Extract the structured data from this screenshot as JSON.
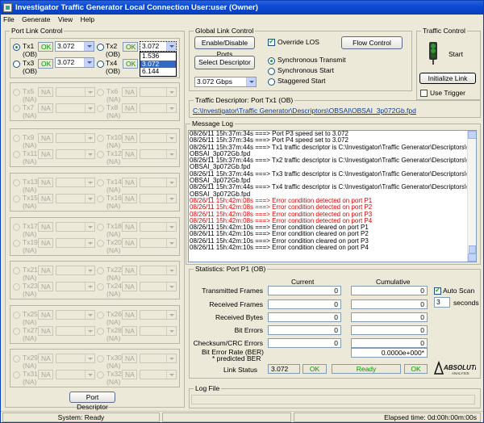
{
  "window": {
    "title": "Investigator  Traffic Generator  Local Connection  User:user (Owner)"
  },
  "menu": [
    "File",
    "Generate",
    "View",
    "Help"
  ],
  "port_link_control": {
    "title": "Port Link Control",
    "active_ports": [
      {
        "label": "Tx1",
        "sub": "(OB)",
        "status": "OK",
        "speed": "3.072"
      },
      {
        "label": "Tx2",
        "sub": "(OB)",
        "status": "OK",
        "speed": "3.072"
      },
      {
        "label": "Tx3",
        "sub": "(OB)",
        "status": "OK",
        "speed": "3.072"
      },
      {
        "label": "Tx4",
        "sub": "(OB)",
        "status": "OK",
        "speed": "3.072"
      }
    ],
    "speed_options": [
      "1.536",
      "3.072",
      "6.144"
    ],
    "selected_speed": "3.072",
    "inactive_groups": [
      [
        [
          "Tx5",
          "(NA)",
          "NA"
        ],
        [
          "Tx6",
          "(NA)",
          "NA"
        ],
        [
          "Tx7",
          "(NA)",
          "NA"
        ],
        [
          "Tx8",
          "(NA)",
          "NA"
        ]
      ],
      [
        [
          "Tx9",
          "(NA)",
          "NA"
        ],
        [
          "Tx10",
          "(NA)",
          "NA"
        ],
        [
          "Tx11",
          "(NA)",
          "NA"
        ],
        [
          "Tx12",
          "(NA)",
          "NA"
        ]
      ],
      [
        [
          "Tx13",
          "(NA)",
          "NA"
        ],
        [
          "Tx14",
          "(NA)",
          "NA"
        ],
        [
          "Tx15",
          "(NA)",
          "NA"
        ],
        [
          "Tx16",
          "(NA)",
          "NA"
        ]
      ],
      [
        [
          "Tx17",
          "(NA)",
          "NA"
        ],
        [
          "Tx18",
          "(NA)",
          "NA"
        ],
        [
          "Tx19",
          "(NA)",
          "NA"
        ],
        [
          "Tx20",
          "(NA)",
          "NA"
        ]
      ],
      [
        [
          "Tx21",
          "(NA)",
          "NA"
        ],
        [
          "Tx22",
          "(NA)",
          "NA"
        ],
        [
          "Tx23",
          "(NA)",
          "NA"
        ],
        [
          "Tx24",
          "(NA)",
          "NA"
        ]
      ],
      [
        [
          "Tx25",
          "(NA)",
          "NA"
        ],
        [
          "Tx26",
          "(NA)",
          "NA"
        ],
        [
          "Tx27",
          "(NA)",
          "NA"
        ],
        [
          "Tx28",
          "(NA)",
          "NA"
        ]
      ],
      [
        [
          "Tx29",
          "(NA)",
          "NA"
        ],
        [
          "Tx30",
          "(NA)",
          "NA"
        ],
        [
          "Tx31",
          "(NA)",
          "NA"
        ],
        [
          "Tx32",
          "(NA)",
          "NA"
        ]
      ]
    ],
    "port_descriptor_button": "Port Descriptor"
  },
  "global_link_control": {
    "title": "Global Link Control",
    "enable_disable_ports": "Enable/Disable Ports",
    "override_los": "Override LOS",
    "flow_control": "Flow Control",
    "select_descriptor": "Select Descriptor",
    "transmit_modes": [
      "Synchronous Transmit",
      "Synchronous Start",
      "Staggered Start"
    ],
    "rate": "3.072 Gbps"
  },
  "traffic_control": {
    "title": "Traffic Control",
    "start": "Start",
    "initialize_link": "Initialize Link",
    "use_trigger": "Use Trigger"
  },
  "traffic_descriptor": {
    "title": "Traffic Descriptor:  Port Tx1 (OB)",
    "path": "C:\\Investigator\\Traffic Generator\\Descriptors\\OBSAI\\OBSAI_3p072Gb.fpd"
  },
  "message_log": {
    "title": "Message Log",
    "lines": [
      {
        "text": "08/26/11 15h:37m:34s  ===> Port P3 speed set to 3.072",
        "color": "#000000"
      },
      {
        "text": "08/26/11 15h:37m:34s  ===> Port P4 speed set to 3.072",
        "color": "#000000"
      },
      {
        "text": "08/26/11 15h:37m:44s  ===> Tx1 traffic descriptor is C:\\Investigator\\Traffic Generator\\Descriptors\\OBSAI\\",
        "color": "#000000"
      },
      {
        "text": "                OBSAI_3p072Gb.fpd",
        "color": "#000000"
      },
      {
        "text": "08/26/11 15h:37m:44s  ===> Tx2 traffic descriptor is C:\\Investigator\\Traffic Generator\\Descriptors\\OBSAI\\",
        "color": "#000000"
      },
      {
        "text": "                OBSAI_3p072Gb.fpd",
        "color": "#000000"
      },
      {
        "text": "08/26/11 15h:37m:44s  ===> Tx3 traffic descriptor is C:\\Investigator\\Traffic Generator\\Descriptors\\OBSAI\\",
        "color": "#000000"
      },
      {
        "text": "                OBSAI_3p072Gb.fpd",
        "color": "#000000"
      },
      {
        "text": "08/26/11 15h:37m:44s  ===> Tx4 traffic descriptor is C:\\Investigator\\Traffic Generator\\Descriptors\\OBSAI\\",
        "color": "#000000"
      },
      {
        "text": "                OBSAI_3p072Gb.fpd",
        "color": "#000000"
      },
      {
        "text": "08/26/11 15h:42m:08s  ===> Error condition detected on port P1",
        "color": "#e00000"
      },
      {
        "text": "08/26/11 15h:42m:08s  ===> Error condition detected on port P2",
        "color": "#e00000"
      },
      {
        "text": "08/26/11 15h:42m:08s  ===> Error condition detected on port P3",
        "color": "#e00000"
      },
      {
        "text": "08/26/11 15h:42m:08s  ===> Error condition detected on port P4",
        "color": "#e00000"
      },
      {
        "text": "08/26/11 15h:42m:10s  ===> Error condition cleared on port P1",
        "color": "#000000"
      },
      {
        "text": "08/26/11 15h:42m:10s  ===> Error condition cleared on port P2",
        "color": "#000000"
      },
      {
        "text": "08/26/11 15h:42m:10s  ===> Error condition cleared on port P3",
        "color": "#000000"
      },
      {
        "text": "08/26/11 15h:42m:10s  ===> Error condition cleared on port P4",
        "color": "#000000"
      }
    ]
  },
  "statistics": {
    "title": "Statistics:  Port P1 (OB)",
    "current_header": "Current",
    "cumulative_header": "Cumulative",
    "rows": [
      {
        "label": "Transmitted Frames",
        "current": "0",
        "cumulative": "0"
      },
      {
        "label": "Received Frames",
        "current": "0",
        "cumulative": "0"
      },
      {
        "label": "Received Bytes",
        "current": "0",
        "cumulative": "0"
      },
      {
        "label": "Bit Errors",
        "current": "0",
        "cumulative": "0"
      },
      {
        "label": "Checksum/CRC Errors",
        "current": "0",
        "cumulative": "0"
      }
    ],
    "ber_label": "Bit Error Rate (BER)",
    "ber_sub": "* predicted BER",
    "ber_value": "0.0000e+000*",
    "auto_scan": "Auto Scan",
    "seconds_value": "3",
    "seconds_label": "seconds",
    "link_status_label": "Link Status",
    "link_speed": "3.072",
    "link_ok": "OK",
    "link_ready": "Ready",
    "link_ok2": "OK",
    "logo": "ABSOLUTE ANALYSIS"
  },
  "log_file": {
    "title": "Log File",
    "value": ""
  },
  "status_bar": {
    "system": "System: Ready",
    "elapsed": "Elapsed time: 0d:00h:00m:00s"
  }
}
